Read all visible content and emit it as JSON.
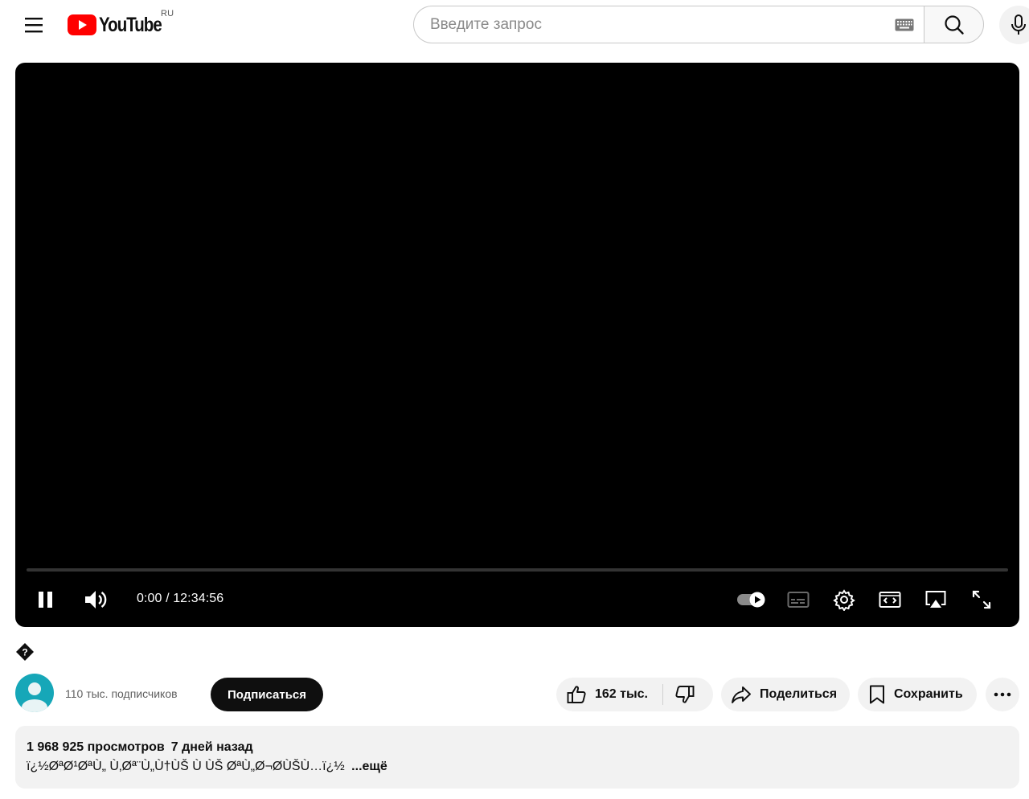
{
  "header": {
    "logo_text": "YouTube",
    "region": "RU",
    "search_placeholder": "Введите запрос"
  },
  "player": {
    "time_current": "0:00",
    "time_separator": " / ",
    "time_total": "12:34:56",
    "progress_fraction": 0,
    "is_playing": true,
    "autoplay": true
  },
  "video": {
    "title_glyph": "?",
    "channel": {
      "subscribers": "110 тыс. подписчиков"
    },
    "subscribe_label": "Подписаться",
    "likes": "162 тыс.",
    "share_label": "Поделиться",
    "save_label": "Сохранить",
    "description": {
      "views": "1 968 925 просмотров",
      "date": "7 дней назад",
      "text": "ï¿½ØªØ¹ØªÙ„ Ù‚Øª¨Ù„Ù†ÙŠ Ù  ÙŠ ØªÙ„Ø¬ØÙŠÙ…ï¿½",
      "more_label": "...ещё"
    }
  },
  "colors": {
    "accent_red": "#ff0000",
    "subscribe_bg": "#0f0f0f",
    "pill_bg": "#f2f2f2",
    "avatar_bg": "#16a7b8"
  },
  "icons": {
    "menu": "hamburger-icon",
    "search": "search-icon",
    "mic": "mic-icon",
    "keyboard": "keyboard-icon",
    "pause": "pause-icon",
    "volume": "volume-icon",
    "autoplay": "autoplay-toggle-icon",
    "subtitles": "subtitles-icon",
    "settings": "gear-icon",
    "theater": "theater-mode-icon",
    "cast": "cast-icon",
    "fullscreen": "fullscreen-icon",
    "like": "thumbs-up-icon",
    "dislike": "thumbs-down-icon",
    "share": "share-icon",
    "save": "bookmark-icon",
    "more": "more-horizontal-icon"
  }
}
